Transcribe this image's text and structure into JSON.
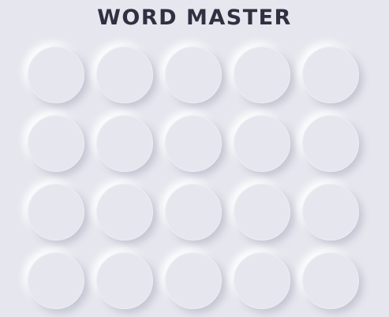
{
  "header": {
    "title": "WORD MASTER"
  },
  "board": {
    "rows": [
      [
        "",
        "",
        "",
        "",
        ""
      ],
      [
        "",
        "",
        "",
        "",
        ""
      ],
      [
        "",
        "",
        "",
        "",
        ""
      ],
      [
        "",
        "",
        "",
        "",
        ""
      ]
    ]
  },
  "colors": {
    "background": "#e6e7ee",
    "title": "#2f3142",
    "shadow_dark": "#c3c5d1",
    "shadow_light": "#ffffff"
  }
}
